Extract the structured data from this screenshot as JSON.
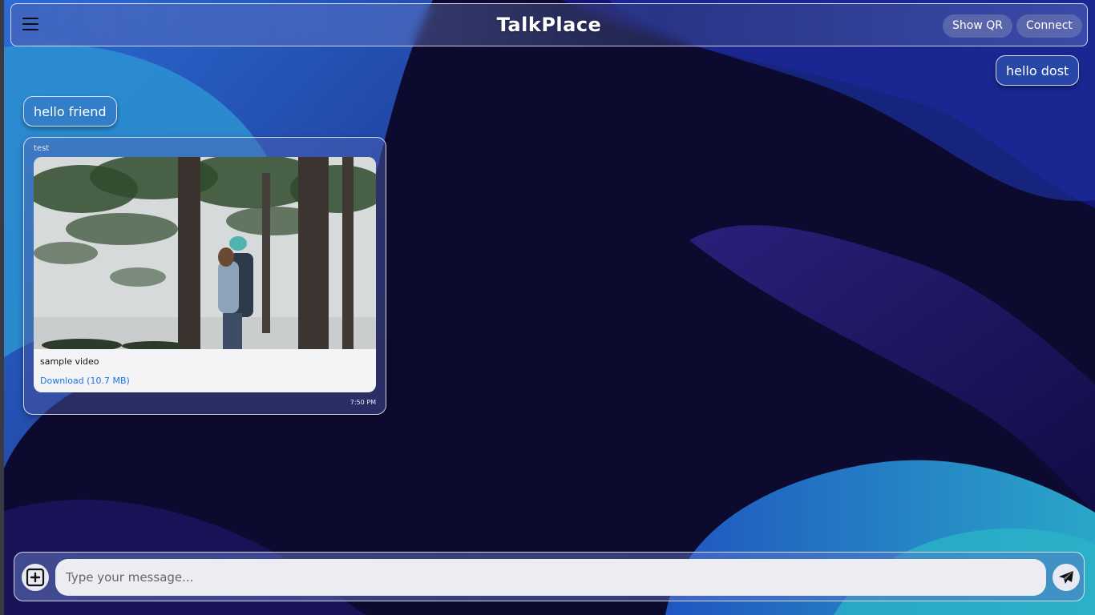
{
  "header": {
    "title": "TalkPlace",
    "menu_icon": "hamburger-menu-icon",
    "show_qr_label": "Show QR",
    "connect_label": "Connect"
  },
  "messages": {
    "outgoing_text": "hello dost",
    "incoming_text": "hello friend",
    "file_message": {
      "sender": "test",
      "file_name": "sample video",
      "download_label": "Download (10.7 MB)",
      "time": "7:50 PM"
    }
  },
  "composer": {
    "placeholder": "Type your message...",
    "attach_icon": "plus-square-icon",
    "send_icon": "paper-plane-icon"
  },
  "colors": {
    "accent": "#1a73e8",
    "background": "#0c0a2e"
  }
}
